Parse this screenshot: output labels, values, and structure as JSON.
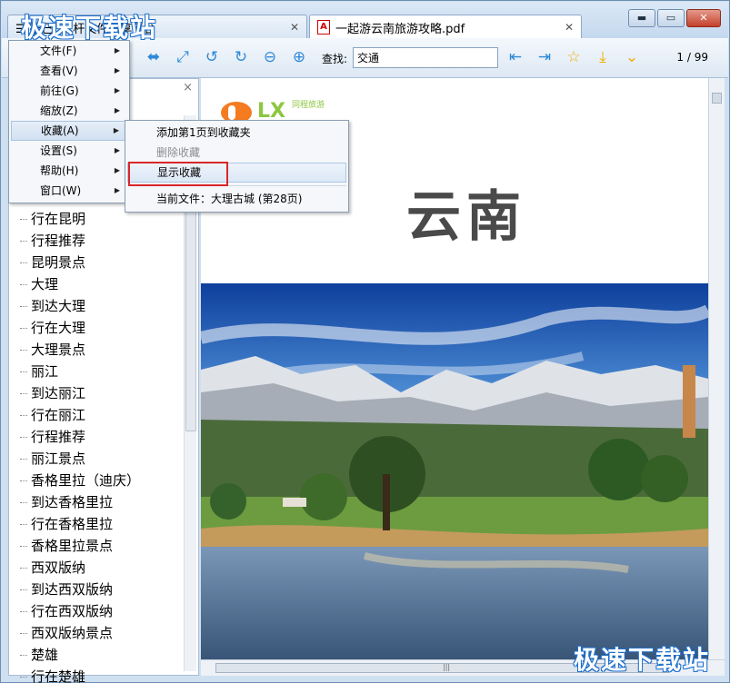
{
  "watermark": {
    "text": "极速下载站"
  },
  "tabs": [
    {
      "label": "☰ 稻已口 :杆文件分享平台",
      "close": "✕"
    },
    {
      "label": "一起游云南旅游攻略.pdf",
      "close": "✕",
      "icon": "pdf-icon"
    }
  ],
  "window_buttons": {
    "minimize": "▬",
    "maximize": "▭",
    "close": "✕"
  },
  "toolbar": {
    "icons": [
      "fit-width-icon",
      "fit-page-icon",
      "rotate-left-icon",
      "rotate-right-icon",
      "zoom-out-icon",
      "zoom-in-icon",
      "prev-result-icon",
      "next-result-icon",
      "star-icon",
      "download-icon",
      "dropdown-icon"
    ],
    "find_label": "查找:",
    "find_value": "交通",
    "page_indicator": "1 / 99"
  },
  "main_menu": {
    "items": [
      {
        "label": "文件(F)"
      },
      {
        "label": "查看(V)"
      },
      {
        "label": "前往(G)"
      },
      {
        "label": "缩放(Z)"
      },
      {
        "label": "收藏(A)"
      },
      {
        "label": "设置(S)"
      },
      {
        "label": "帮助(H)"
      },
      {
        "label": "窗口(W)"
      }
    ],
    "arrow": "▶"
  },
  "submenu": {
    "add": "添加第1页到收藏夹",
    "remove": "删除收藏",
    "show": "显示收藏",
    "current": "当前文件：大理古城 (第28页)"
  },
  "outline": {
    "close": "×",
    "items": [
      "行在昆明",
      "行程推荐",
      "昆明景点",
      "大理",
      "到达大理",
      "行在大理",
      "大理景点",
      "丽江",
      "到达丽江",
      "行在丽江",
      "行程推荐",
      "丽江景点",
      "香格里拉（迪庆）",
      "到达香格里拉",
      "行在香格里拉",
      "香格里拉景点",
      "西双版纳",
      "到达西双版纳",
      "行在西双版纳",
      "西双版纳景点",
      "楚雄",
      "行在楚雄"
    ]
  },
  "document": {
    "logo_text": "LX",
    "logo_tag": "同程旅游",
    "title": "云南"
  },
  "scroll": {
    "grip": "|||"
  }
}
